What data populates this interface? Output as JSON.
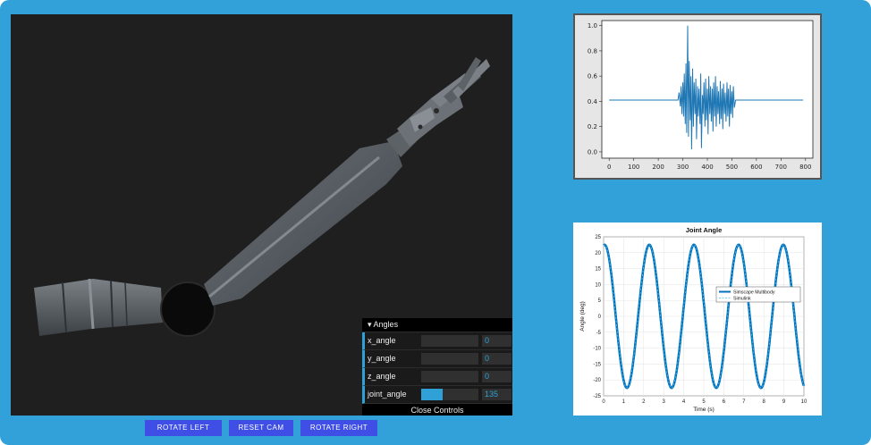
{
  "gui": {
    "folder": "Angles",
    "close_label": "Close Controls",
    "controls": [
      {
        "label": "x_angle",
        "value": "0",
        "fraction": 0
      },
      {
        "label": "y_angle",
        "value": "0",
        "fraction": 0
      },
      {
        "label": "z_angle",
        "value": "0",
        "fraction": 0
      },
      {
        "label": "joint_angle",
        "value": "135",
        "fraction": 0.375
      }
    ]
  },
  "buttons": {
    "rotate_left": "ROTATE LEFT",
    "reset_cam": "RESET CAM",
    "rotate_right": "ROTATE RIGHT"
  },
  "colors": {
    "frame": "#33a1d9",
    "viewport": "#1f1f1f",
    "accent": "#2fa1d6",
    "button": "#3f4fe6",
    "plot_line": "#1f77b4",
    "matlab_line": "#0072bd"
  },
  "chart_data": [
    {
      "type": "line",
      "title": "",
      "xlabel": "",
      "ylabel": "",
      "x_ticks": [
        "0",
        "100",
        "200",
        "300",
        "400",
        "500",
        "600",
        "700",
        "800"
      ],
      "y_ticks": [
        "0.0",
        "0.2",
        "0.4",
        "0.6",
        "0.8",
        "1.0"
      ],
      "xlim": [
        -30,
        830
      ],
      "ylim": [
        -0.05,
        1.04
      ],
      "baseline": 0.41,
      "noise_start": 280,
      "noise_end": 515,
      "x": [
        0,
        280,
        285,
        290,
        293,
        296,
        300,
        303,
        306,
        310,
        313,
        316,
        320,
        323,
        326,
        330,
        333,
        336,
        340,
        343,
        346,
        350,
        353,
        356,
        360,
        363,
        366,
        370,
        373,
        376,
        380,
        383,
        386,
        390,
        393,
        396,
        400,
        403,
        406,
        410,
        413,
        416,
        420,
        423,
        426,
        430,
        433,
        436,
        440,
        443,
        446,
        450,
        453,
        456,
        460,
        463,
        466,
        470,
        473,
        476,
        480,
        483,
        486,
        490,
        493,
        496,
        500,
        503,
        506,
        510,
        515,
        790
      ],
      "y": [
        0.41,
        0.41,
        0.47,
        0.36,
        0.52,
        0.3,
        0.55,
        0.28,
        0.62,
        0.22,
        0.7,
        0.15,
        1.0,
        0.12,
        0.72,
        0.25,
        0.6,
        0.02,
        0.66,
        0.2,
        0.55,
        0.3,
        0.58,
        0.1,
        0.52,
        0.28,
        0.5,
        0.22,
        0.62,
        0.03,
        0.45,
        0.3,
        0.55,
        0.2,
        0.58,
        0.25,
        0.5,
        0.14,
        0.6,
        0.3,
        0.52,
        0.24,
        0.5,
        0.16,
        0.55,
        0.28,
        0.6,
        0.2,
        0.52,
        0.3,
        0.48,
        0.22,
        0.56,
        0.26,
        0.5,
        0.18,
        0.54,
        0.3,
        0.47,
        0.24,
        0.55,
        0.28,
        0.5,
        0.2,
        0.53,
        0.3,
        0.48,
        0.27,
        0.52,
        0.35,
        0.41,
        0.41
      ]
    },
    {
      "type": "line",
      "title": "Joint Angle",
      "xlabel": "Time (s)",
      "ylabel": "Angle (deg)",
      "xlim": [
        0,
        10
      ],
      "ylim": [
        -25,
        25
      ],
      "x_ticks": [
        "0",
        "1",
        "2",
        "3",
        "4",
        "5",
        "6",
        "7",
        "8",
        "9",
        "10"
      ],
      "y_ticks": [
        "25",
        "20",
        "15",
        "10",
        "5",
        "0",
        "-5",
        "-10",
        "-15",
        "-20",
        "-25"
      ],
      "amplitude": 22.5,
      "period": 2.23,
      "phase_peak_at": 0.05,
      "series": [
        {
          "name": "Simscape Multibody"
        },
        {
          "name": "Simulink"
        }
      ],
      "grid": true,
      "legend": "right"
    }
  ]
}
